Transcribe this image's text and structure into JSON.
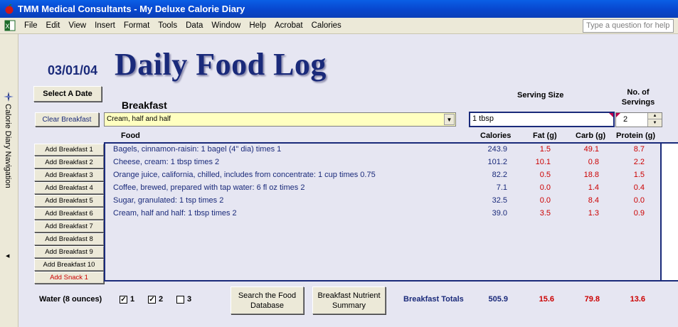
{
  "window": {
    "title": "TMM Medical Consultants - My Deluxe Calorie Diary"
  },
  "menu": {
    "items": [
      "File",
      "Edit",
      "View",
      "Insert",
      "Format",
      "Tools",
      "Data",
      "Window",
      "Help",
      "Acrobat",
      "Calories"
    ],
    "help_placeholder": "Type a question for help"
  },
  "nav": {
    "label": "Calorie Diary Navigation"
  },
  "header": {
    "date": "03/01/04",
    "title": "Daily Food Log",
    "select_date": "Select A Date"
  },
  "meal": {
    "name": "Breakfast",
    "clear_label": "Clear Breakfast",
    "selected_food": "Cream, half and half",
    "serving_size_label": "Serving Size",
    "serving_size_value": "1 tbsp",
    "servings_label": "No. of Servings",
    "servings_value": "2"
  },
  "columns": {
    "food": "Food",
    "calories": "Calories",
    "fat": "Fat (g)",
    "carb": "Carb (g)",
    "protein": "Protein (g)"
  },
  "add_buttons": [
    "Add Breakfast 1",
    "Add Breakfast 2",
    "Add Breakfast 3",
    "Add Breakfast 4",
    "Add Breakfast 5",
    "Add Breakfast 6",
    "Add Breakfast 7",
    "Add Breakfast 8",
    "Add Breakfast 9",
    "Add Breakfast 10",
    "Add Snack 1"
  ],
  "rows": [
    {
      "food": "Bagels, cinnamon-raisin: 1 bagel (4\" dia) times 1",
      "calories": "243.9",
      "fat": "1.5",
      "carb": "49.1",
      "protein": "8.7"
    },
    {
      "food": "Cheese, cream: 1 tbsp times 2",
      "calories": "101.2",
      "fat": "10.1",
      "carb": "0.8",
      "protein": "2.2"
    },
    {
      "food": "Orange juice, california, chilled, includes from concentrate: 1 cup times 0.75",
      "calories": "82.2",
      "fat": "0.5",
      "carb": "18.8",
      "protein": "1.5"
    },
    {
      "food": "Coffee, brewed, prepared with tap water: 6 fl oz times 2",
      "calories": "7.1",
      "fat": "0.0",
      "carb": "1.4",
      "protein": "0.4"
    },
    {
      "food": "Sugar, granulated: 1 tsp times 2",
      "calories": "32.5",
      "fat": "0.0",
      "carb": "8.4",
      "protein": "0.0"
    },
    {
      "food": "Cream, half and half: 1 tbsp times 2",
      "calories": "39.0",
      "fat": "3.5",
      "carb": "1.3",
      "protein": "0.9"
    }
  ],
  "water": {
    "label": "Water (8 ounces)",
    "checks": [
      {
        "label": "1",
        "checked": true
      },
      {
        "label": "2",
        "checked": true
      },
      {
        "label": "3",
        "checked": false
      }
    ]
  },
  "buttons": {
    "search_db": "Search the Food Database",
    "nutrient_summary": "Breakfast Nutrient Summary"
  },
  "totals": {
    "label": "Breakfast Totals",
    "calories": "505.9",
    "fat": "15.6",
    "carb": "79.8",
    "protein": "13.6"
  },
  "colors": {
    "titlebar": "#0a5fe6",
    "accent_navy": "#1a2a7a",
    "nutrient_red": "#cc0000",
    "input_yellow": "#ffffc0"
  }
}
